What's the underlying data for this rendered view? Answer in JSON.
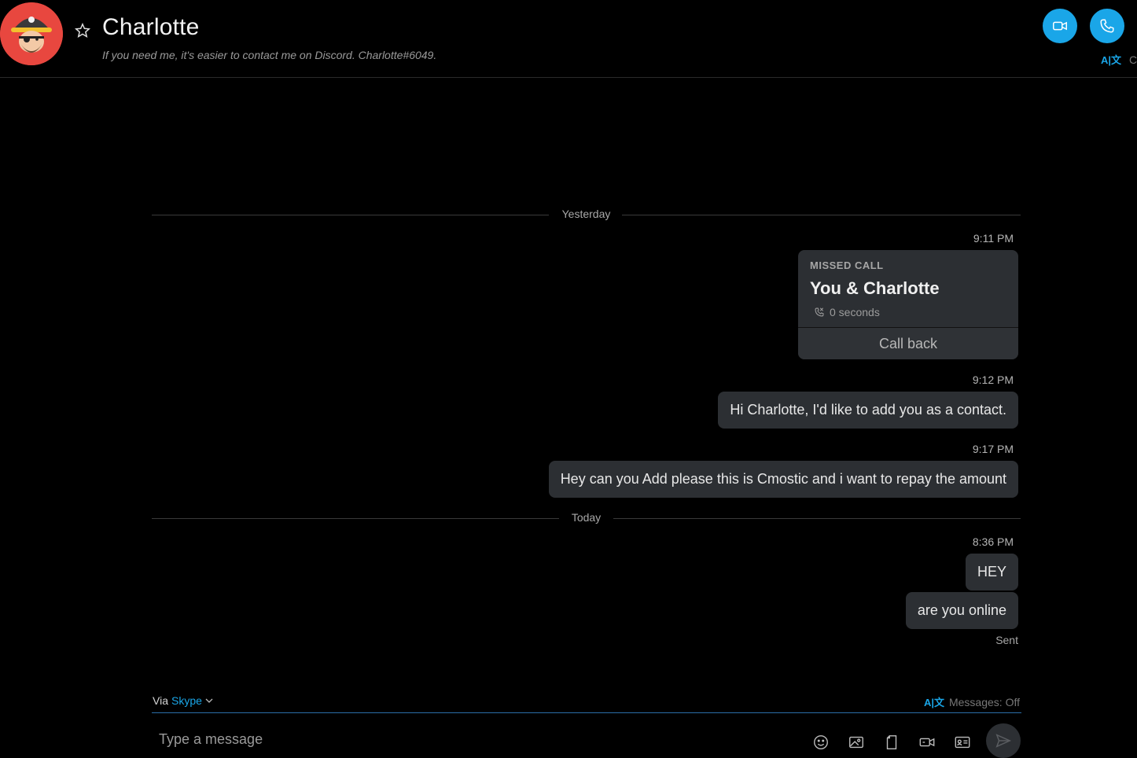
{
  "header": {
    "contact_name": "Charlotte",
    "mood_message": "If you need me, it's easier to contact me on Discord. Charlotte#6049.",
    "translate_partial": "Ca"
  },
  "colors": {
    "accent": "#1aa6e8",
    "avatar_bg": "#e8473f",
    "bubble_bg": "#2c2f33",
    "background": "#000000"
  },
  "dividers": {
    "yesterday": "Yesterday",
    "today": "Today"
  },
  "messages": [
    {
      "time": "9:11 PM",
      "type": "missed_call",
      "label": "MISSED CALL",
      "title": "You & Charlotte",
      "duration": "0 seconds",
      "action": "Call back"
    },
    {
      "time": "9:12 PM",
      "type": "text",
      "text": "Hi Charlotte, I'd like to add you as a contact."
    },
    {
      "time": "9:17 PM",
      "type": "text",
      "text": "Hey can you Add please this is Cmostic and i want to repay the amount"
    },
    {
      "time": "8:36 PM",
      "type": "text",
      "text": "HEY"
    },
    {
      "time": "",
      "type": "text",
      "text": "are you online"
    }
  ],
  "status": {
    "sent": "Sent"
  },
  "composer": {
    "via_label": "Via",
    "via_service": "Skype",
    "translate_status": "Messages: Off",
    "placeholder": "Type a message"
  },
  "icons": {
    "star": "star-icon",
    "video": "video-camera-icon",
    "call": "phone-icon",
    "translate": "translate-icon",
    "emoji": "emoji-icon",
    "image": "image-icon",
    "file": "file-icon",
    "video_message": "video-message-icon",
    "contact_card": "contact-card-icon",
    "send": "send-icon"
  }
}
